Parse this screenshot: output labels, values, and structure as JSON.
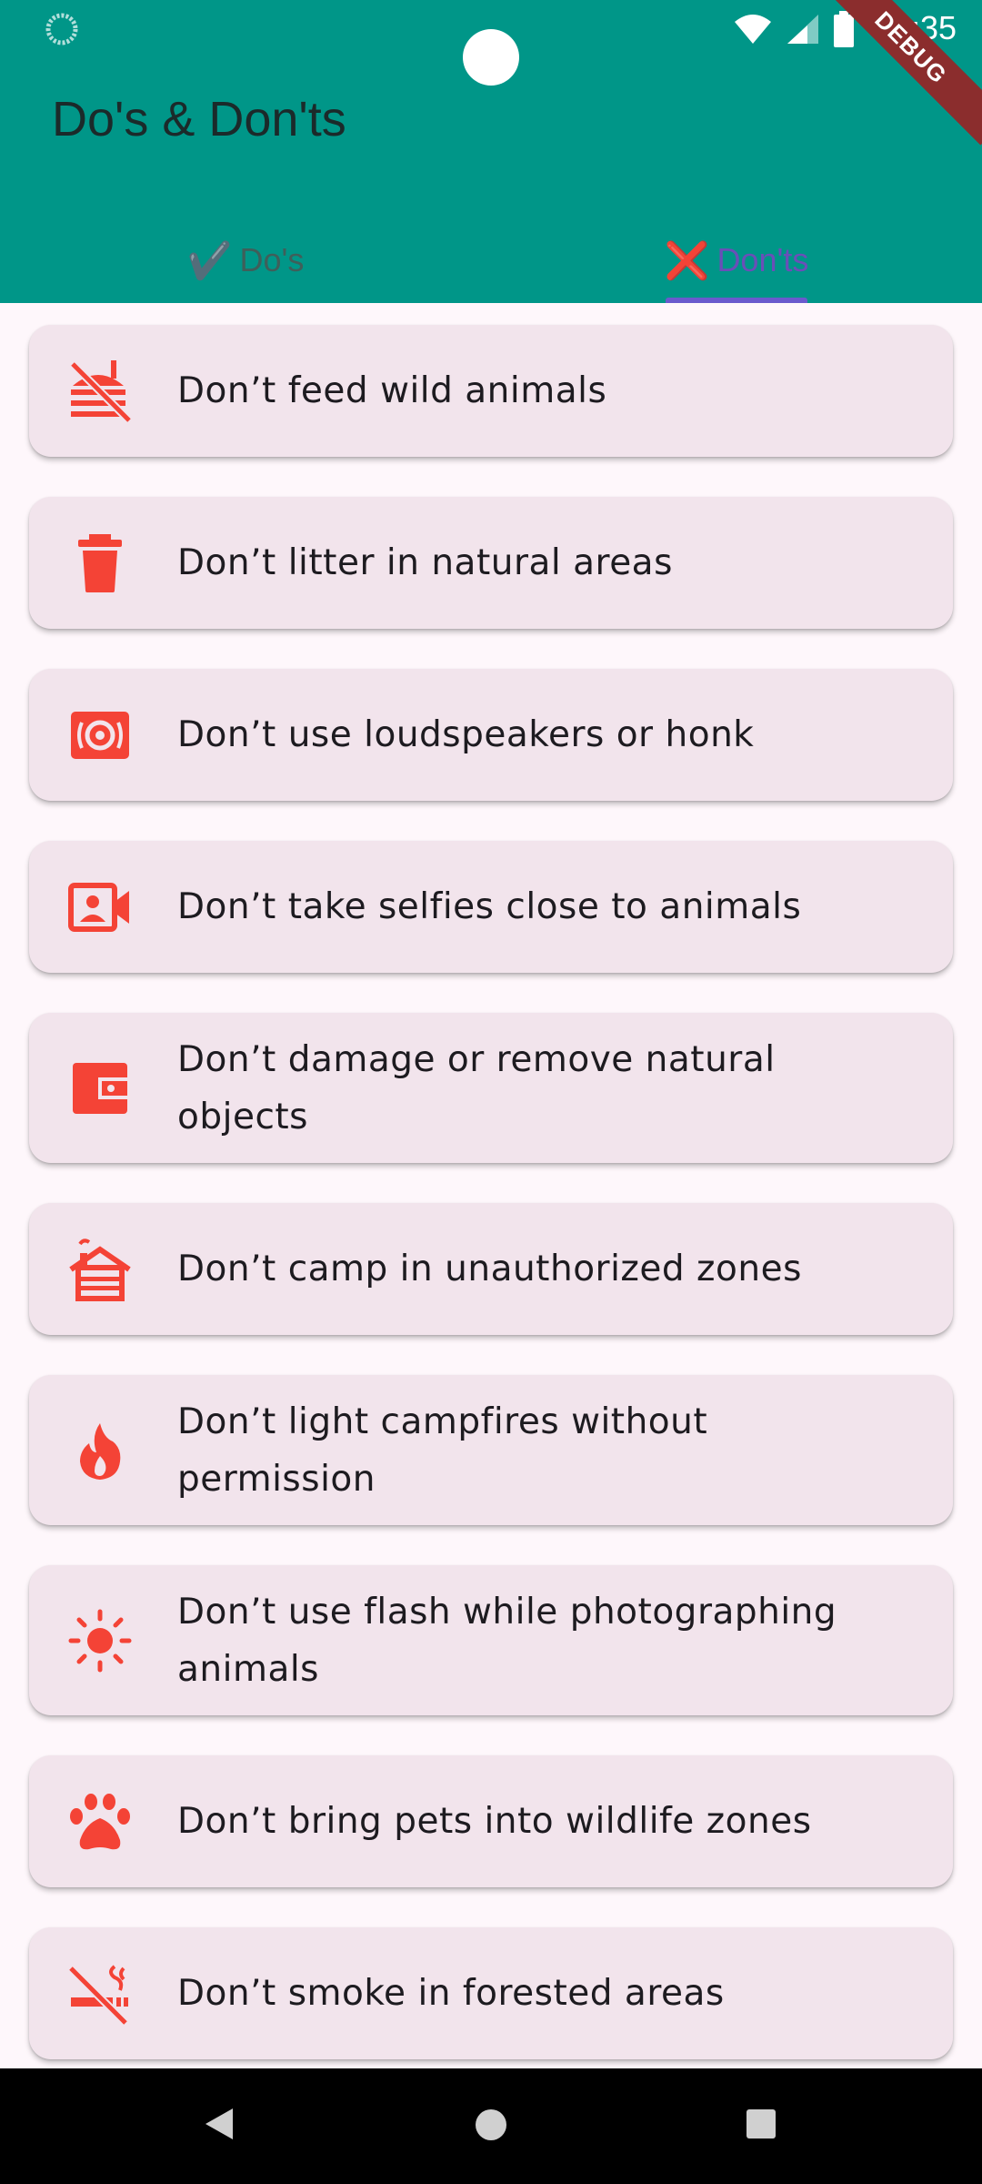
{
  "status_bar": {
    "time": "11:35",
    "debug_label": "DEBUG"
  },
  "app_bar": {
    "title": "Do's & Don'ts"
  },
  "tabs": [
    {
      "glyph": "✔️",
      "label": "Do's",
      "selected": false
    },
    {
      "glyph": "❌",
      "label": "Don'ts",
      "selected": true
    }
  ],
  "colors": {
    "appbar": "#009688",
    "accent_red": "#f44336",
    "card_bg": "#f2e4ec",
    "indicator": "#6a5acd"
  },
  "donts": [
    {
      "icon": "no-food-icon",
      "text": "Don’t feed wild animals"
    },
    {
      "icon": "trash-icon",
      "text": "Don’t litter in natural areas"
    },
    {
      "icon": "speaker-icon",
      "text": "Don’t use loudspeakers or honk"
    },
    {
      "icon": "video-person-icon",
      "text": "Don’t take selfies close to animals"
    },
    {
      "icon": "wallet-icon",
      "text": "Don’t damage or remove natural objects"
    },
    {
      "icon": "cabin-icon",
      "text": "Don’t camp in unauthorized zones"
    },
    {
      "icon": "fire-icon",
      "text": "Don’t light campfires without permission"
    },
    {
      "icon": "sun-icon",
      "text": "Don’t use flash while photographing animals"
    },
    {
      "icon": "paw-icon",
      "text": "Don’t bring pets into wildlife zones"
    },
    {
      "icon": "no-smoking-icon",
      "text": "Don’t smoke in forested areas"
    }
  ]
}
